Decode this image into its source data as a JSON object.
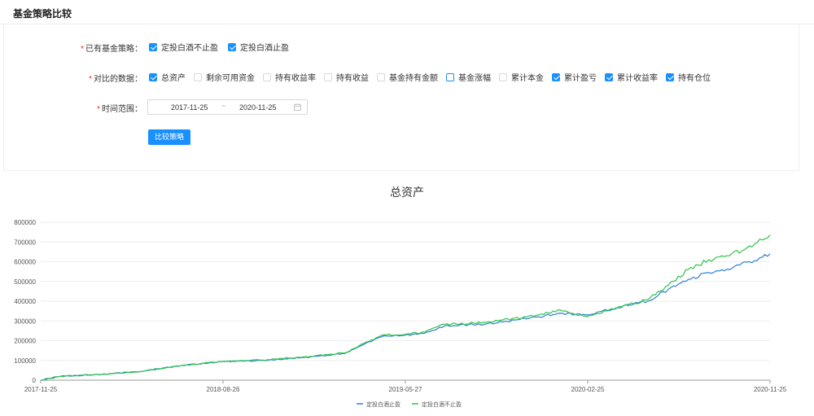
{
  "page": {
    "title": "基金策略比较"
  },
  "form": {
    "strategies": {
      "label": "已有基金策略：",
      "options": [
        {
          "label": "定投白酒不止盈",
          "checked": true
        },
        {
          "label": "定投白酒止盈",
          "checked": true
        }
      ]
    },
    "metrics": {
      "label": "对比的数据：",
      "options": [
        {
          "label": "总资产",
          "checked": true
        },
        {
          "label": "剩余可用资金",
          "checked": false
        },
        {
          "label": "持有收益率",
          "checked": false
        },
        {
          "label": "持有收益",
          "checked": false
        },
        {
          "label": "基金持有金额",
          "checked": false
        },
        {
          "label": "基金涨幅",
          "checked": false,
          "focused": true
        },
        {
          "label": "累计本金",
          "checked": false
        },
        {
          "label": "累计盈亏",
          "checked": true
        },
        {
          "label": "累计收益率",
          "checked": true
        },
        {
          "label": "持有仓位",
          "checked": true
        }
      ]
    },
    "time_range": {
      "label": "时间范围：",
      "start": "2017-11-25",
      "separator": "~",
      "end": "2020-11-25"
    },
    "compare_button": "比较策略"
  },
  "colors": {
    "accent": "#1890ff",
    "required": "#f5222d"
  },
  "icons": {
    "date": "calendar-icon"
  },
  "chart_data": {
    "type": "line",
    "title": "总资产",
    "x_start": "2017-11-25",
    "x_end": "2020-11-25",
    "x_ticks": [
      "2017-11-25",
      "2018-08-26",
      "2019-05-27",
      "2020-02-25",
      "2020-11-25"
    ],
    "ylim": [
      0,
      800000
    ],
    "y_ticks": [
      0,
      100000,
      200000,
      300000,
      400000,
      500000,
      600000,
      700000,
      800000
    ],
    "grid": true,
    "legend_position": "bottom",
    "series": [
      {
        "name": "定投白酒止盈",
        "color": "#2d7fd6",
        "points": [
          [
            "2017-11-25",
            0
          ],
          [
            "2017-12-25",
            20000
          ],
          [
            "2018-02-25",
            30000
          ],
          [
            "2018-04-25",
            45000
          ],
          [
            "2018-06-25",
            75000
          ],
          [
            "2018-08-26",
            95000
          ],
          [
            "2018-10-25",
            100000
          ],
          [
            "2018-12-25",
            115000
          ],
          [
            "2019-02-25",
            135000
          ],
          [
            "2019-03-25",
            180000
          ],
          [
            "2019-04-25",
            225000
          ],
          [
            "2019-05-27",
            228000
          ],
          [
            "2019-06-25",
            238000
          ],
          [
            "2019-07-25",
            275000
          ],
          [
            "2019-09-25",
            285000
          ],
          [
            "2019-11-25",
            310000
          ],
          [
            "2020-01-15",
            340000
          ],
          [
            "2020-02-25",
            330000
          ],
          [
            "2020-03-25",
            355000
          ],
          [
            "2020-05-25",
            400000
          ],
          [
            "2020-06-25",
            460000
          ],
          [
            "2020-07-25",
            510000
          ],
          [
            "2020-08-25",
            545000
          ],
          [
            "2020-09-25",
            560000
          ],
          [
            "2020-10-25",
            600000
          ],
          [
            "2020-11-25",
            640000
          ]
        ]
      },
      {
        "name": "定投白酒不止盈",
        "color": "#2ec44a",
        "points": [
          [
            "2017-11-25",
            0
          ],
          [
            "2017-12-25",
            20000
          ],
          [
            "2018-02-25",
            30000
          ],
          [
            "2018-04-25",
            45000
          ],
          [
            "2018-06-25",
            75000
          ],
          [
            "2018-08-26",
            95000
          ],
          [
            "2018-10-25",
            102000
          ],
          [
            "2018-12-25",
            118000
          ],
          [
            "2019-02-25",
            138000
          ],
          [
            "2019-03-25",
            185000
          ],
          [
            "2019-04-25",
            230000
          ],
          [
            "2019-05-27",
            232000
          ],
          [
            "2019-06-25",
            244000
          ],
          [
            "2019-07-25",
            283000
          ],
          [
            "2019-09-25",
            292000
          ],
          [
            "2019-11-25",
            320000
          ],
          [
            "2020-01-15",
            355000
          ],
          [
            "2020-02-25",
            322000
          ],
          [
            "2020-03-25",
            350000
          ],
          [
            "2020-05-25",
            408000
          ],
          [
            "2020-06-25",
            480000
          ],
          [
            "2020-07-25",
            560000
          ],
          [
            "2020-08-25",
            610000
          ],
          [
            "2020-09-25",
            630000
          ],
          [
            "2020-10-25",
            680000
          ],
          [
            "2020-11-25",
            735000
          ]
        ]
      }
    ]
  }
}
